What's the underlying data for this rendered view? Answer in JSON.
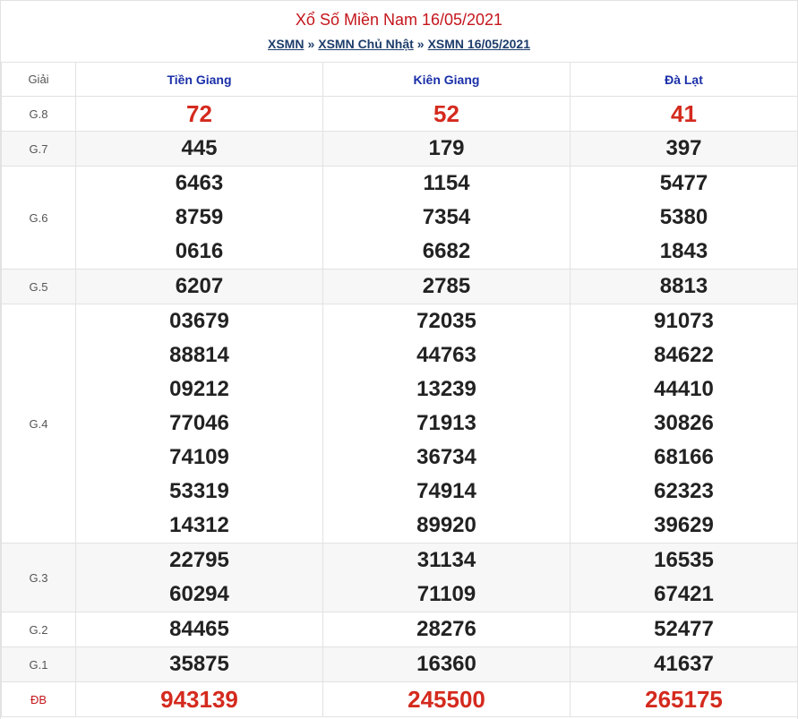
{
  "header": {
    "title": "Xổ Số Miền Nam 16/05/2021",
    "breadcrumbs": [
      "XSMN",
      "XSMN Chủ Nhật",
      "XSMN 16/05/2021"
    ],
    "separator": "»"
  },
  "table": {
    "label_header": "Giải",
    "provinces": [
      "Tiền Giang",
      "Kiên Giang",
      "Đà Lạt"
    ],
    "rows": [
      {
        "label": "G.8",
        "cells": [
          [
            "72"
          ],
          [
            "52"
          ],
          [
            "41"
          ]
        ]
      },
      {
        "label": "G.7",
        "cells": [
          [
            "445"
          ],
          [
            "179"
          ],
          [
            "397"
          ]
        ]
      },
      {
        "label": "G.6",
        "cells": [
          [
            "6463",
            "8759",
            "0616"
          ],
          [
            "1154",
            "7354",
            "6682"
          ],
          [
            "5477",
            "5380",
            "1843"
          ]
        ]
      },
      {
        "label": "G.5",
        "cells": [
          [
            "6207"
          ],
          [
            "2785"
          ],
          [
            "8813"
          ]
        ]
      },
      {
        "label": "G.4",
        "cells": [
          [
            "03679",
            "88814",
            "09212",
            "77046",
            "74109",
            "53319",
            "14312"
          ],
          [
            "72035",
            "44763",
            "13239",
            "71913",
            "36734",
            "74914",
            "89920"
          ],
          [
            "91073",
            "84622",
            "44410",
            "30826",
            "68166",
            "62323",
            "39629"
          ]
        ]
      },
      {
        "label": "G.3",
        "cells": [
          [
            "22795",
            "60294"
          ],
          [
            "31134",
            "71109"
          ],
          [
            "16535",
            "67421"
          ]
        ]
      },
      {
        "label": "G.2",
        "cells": [
          [
            "84465"
          ],
          [
            "28276"
          ],
          [
            "52477"
          ]
        ]
      },
      {
        "label": "G.1",
        "cells": [
          [
            "35875"
          ],
          [
            "16360"
          ],
          [
            "41637"
          ]
        ]
      },
      {
        "label": "ĐB",
        "cells": [
          [
            "943139"
          ],
          [
            "245500"
          ],
          [
            "265175"
          ]
        ]
      }
    ]
  },
  "colors": {
    "title": "#c4161c",
    "province_header": "#1a2fa8",
    "highlight_number": "#d42a1e",
    "breadcrumb": "#1d3d6b"
  }
}
